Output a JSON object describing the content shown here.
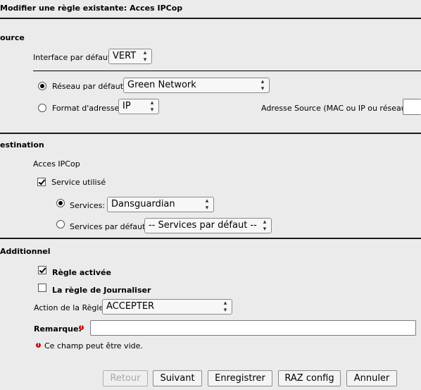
{
  "page": {
    "title": "Modifier une règle existante: Acces IPCop"
  },
  "source": {
    "heading": "ource",
    "interface_label": "Interface par défaut:",
    "interface_value": "VERT",
    "network_radio_label": "Réseau par défaut:",
    "network_value": "Green Network",
    "format_radio_label": "Format d'adresse:",
    "format_value": "IP",
    "address_source_label": "Adresse Source (MAC ou IP ou réseau):",
    "address_source_value": ""
  },
  "destination": {
    "heading": "estination",
    "target_label": "Acces IPCop",
    "service_used_label": "Service utilisé",
    "services_radio_label": "Services:",
    "services_value": "Dansguardian",
    "default_services_radio_label": "Services par défaut:",
    "default_services_value": "-- Services par défaut --"
  },
  "additional": {
    "heading": "Additionnel",
    "rule_enabled_label": "Règle activée",
    "rule_log_label": "La règle de Journaliser",
    "action_label": "Action de la Règle:",
    "action_value": "ACCEPTER",
    "remark_label": "Remarque:",
    "remark_value": "",
    "hint_text": "Ce champ peut être vide.",
    "required_marker": "!"
  },
  "buttons": {
    "back": "Retour",
    "next": "Suivant",
    "save": "Enregistrer",
    "reset": "RAZ config",
    "cancel": "Annuler"
  },
  "state": {
    "network_radio_selected": true,
    "format_radio_selected": false,
    "service_used_checked": true,
    "services_radio_selected": true,
    "default_services_radio_selected": false,
    "rule_enabled_checked": true,
    "rule_log_checked": false,
    "back_disabled": true
  },
  "icons": {
    "select_arrow": "updown-chevron-icon",
    "required": "red-exclamation-icon"
  },
  "colors": {
    "background": "#ebebeb",
    "required_marker": "#cc0000"
  }
}
